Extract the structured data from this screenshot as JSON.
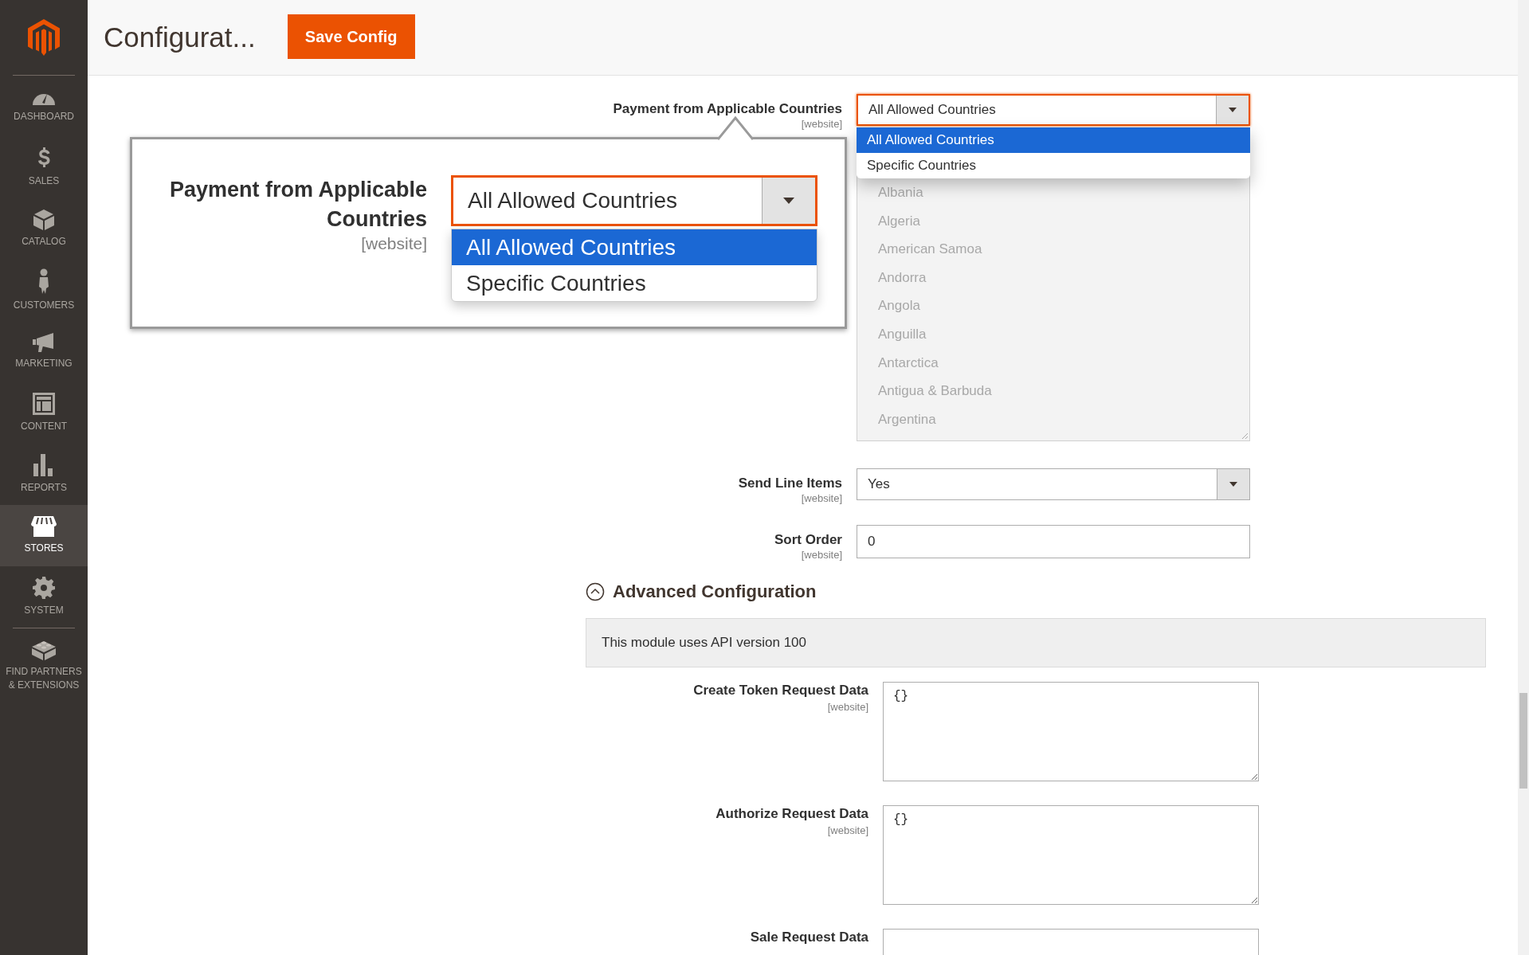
{
  "sidebar": {
    "items": [
      {
        "kind": "dashboard",
        "label": "DASHBOARD",
        "selected": false
      },
      {
        "kind": "sales",
        "label": "SALES",
        "selected": false
      },
      {
        "kind": "catalog",
        "label": "CATALOG",
        "selected": false
      },
      {
        "kind": "customers",
        "label": "CUSTOMERS",
        "selected": false
      },
      {
        "kind": "marketing",
        "label": "MARKETING",
        "selected": false
      },
      {
        "kind": "content",
        "label": "CONTENT",
        "selected": false
      },
      {
        "kind": "reports",
        "label": "REPORTS",
        "selected": false
      },
      {
        "kind": "stores",
        "label": "STORES",
        "selected": true
      },
      {
        "kind": "system",
        "label": "SYSTEM",
        "selected": false
      },
      {
        "kind": "extensions",
        "label": "FIND PARTNERS & EXTENSIONS",
        "selected": false
      }
    ]
  },
  "header": {
    "title": "Configurat...",
    "save_button": "Save Config"
  },
  "payment_field": {
    "label": "Payment from Applicable Countries",
    "scope": "[website]",
    "value": "All Allowed Countries",
    "open": true,
    "options": [
      {
        "label": "All Allowed Countries",
        "selected": true
      },
      {
        "label": "Specific Countries",
        "selected": false
      }
    ]
  },
  "country_list": {
    "disabled": true,
    "items": [
      "Albania",
      "Algeria",
      "American Samoa",
      "Andorra",
      "Angola",
      "Anguilla",
      "Antarctica",
      "Antigua & Barbuda",
      "Argentina"
    ]
  },
  "fields": [
    {
      "kind": "select",
      "label": "Send Line Items",
      "scope": "[website]",
      "value": "Yes"
    },
    {
      "kind": "text",
      "label": "Sort Order",
      "scope": "[website]",
      "value": "0"
    }
  ],
  "advanced": {
    "title": "Advanced Configuration",
    "expanded": true,
    "note": "This module uses API version 100",
    "fields": [
      {
        "label": "Create Token Request Data",
        "scope": "[website]",
        "value": "{}"
      },
      {
        "label": "Authorize Request Data",
        "scope": "[website]",
        "value": "{}"
      },
      {
        "label": "Sale Request Data"
      }
    ]
  },
  "zoom_callout": {
    "label": "Payment from Applicable Countries",
    "scope": "[website]",
    "value": "All Allowed Countries",
    "open": true,
    "options": [
      {
        "label": "All Allowed Countries",
        "selected": true
      },
      {
        "label": "Specific Countries",
        "selected": false
      }
    ]
  }
}
